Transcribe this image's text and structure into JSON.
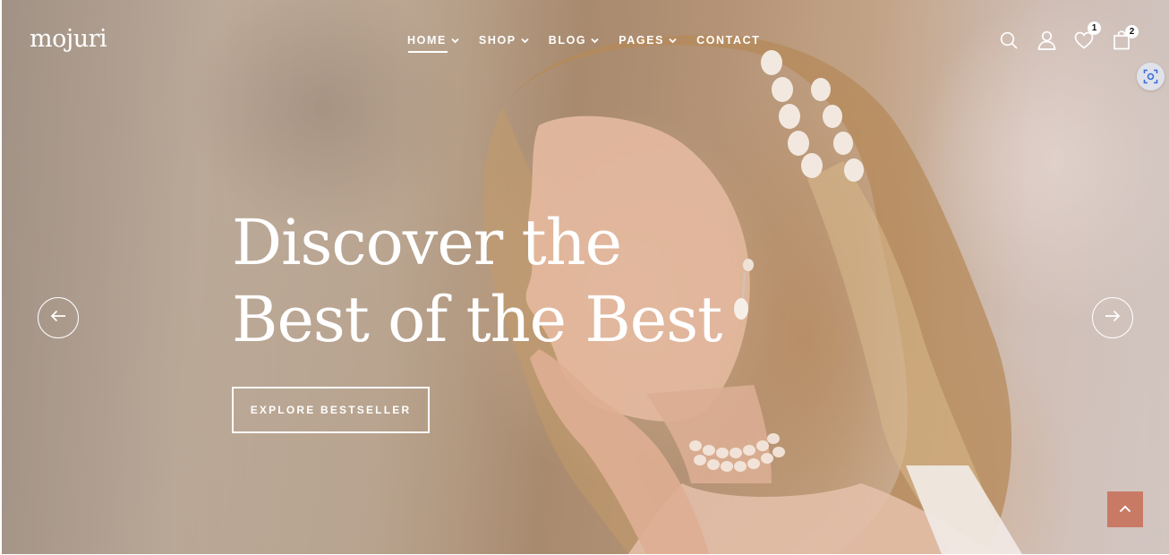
{
  "brand": {
    "logo": "mojuri"
  },
  "nav": {
    "items": [
      {
        "label": "HOME",
        "dropdown": true,
        "active": true
      },
      {
        "label": "SHOP",
        "dropdown": true
      },
      {
        "label": "BLOG",
        "dropdown": true
      },
      {
        "label": "PAGES",
        "dropdown": true
      },
      {
        "label": "CONTACT",
        "dropdown": false
      }
    ]
  },
  "header_icons": {
    "search": "search-icon",
    "account": "user-icon",
    "wishlist": {
      "icon": "heart-icon",
      "count": "1"
    },
    "cart": {
      "icon": "shopping-bag-icon",
      "count": "2"
    }
  },
  "hero": {
    "headline_line1": "Discover the",
    "headline_line2": "Best of the Best",
    "cta_label": "EXPLORE BESTSELLER",
    "prev_icon": "arrow-left-icon",
    "next_icon": "arrow-right-icon"
  },
  "widgets": {
    "scan_icon": "screenshot-scan-icon",
    "back_to_top_icon": "chevron-up-icon"
  },
  "colors": {
    "text_on_hero": "#ffffff",
    "accent_back_to_top": "#c97a65"
  }
}
